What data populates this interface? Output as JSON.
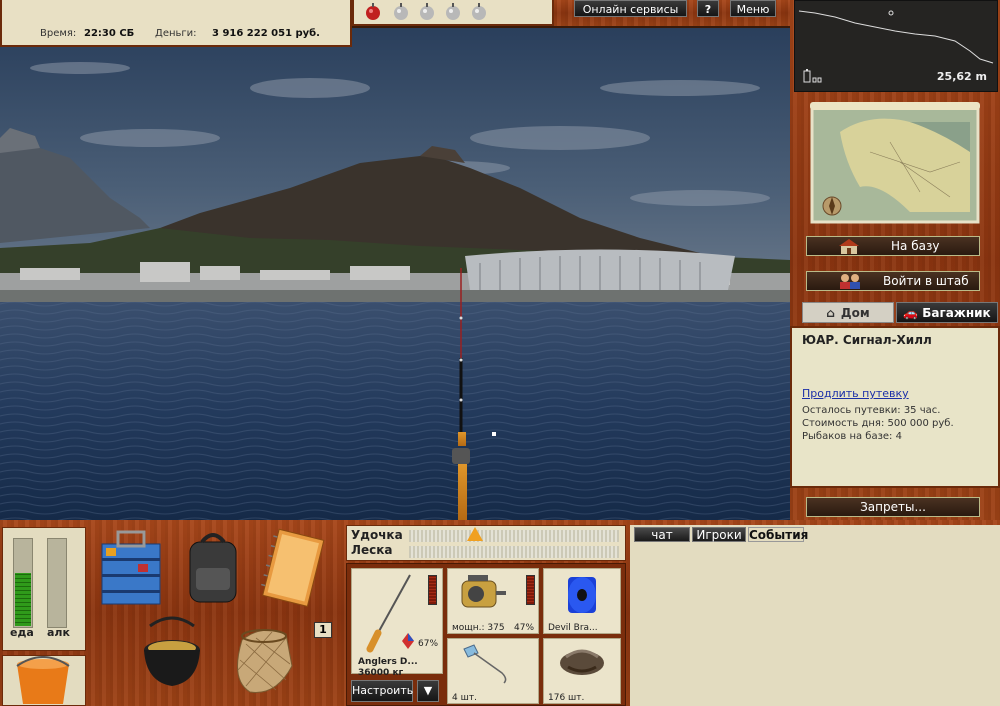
{
  "top": {
    "time_label": "Время:",
    "time_value": "22:30 СБ",
    "money_label": "Деньги:",
    "money_value": "3 916 222 051 руб.",
    "online_button": "Онлайн сервисы",
    "help_button": "?",
    "menu_button": "Меню"
  },
  "depth": {
    "value": "25,62 m"
  },
  "nav": {
    "to_base": "На базу",
    "enter_hq": "Войти в штаб",
    "tab_home": "Дом",
    "tab_trunk": "Багажник",
    "bans_button": "Запреты..."
  },
  "info": {
    "location": "ЮАР. Сигнал-Хилл",
    "extend_link": "Продлить путевку",
    "remaining": "Осталось путевки: 35 час.",
    "day_cost": "Стоимость дня: 500 000 руб.",
    "anglers": "Рыбаков на базе: 4"
  },
  "meters": {
    "food_label": "еда",
    "food_level": 0.62,
    "alc_label": "алк",
    "alc_level": 0.0
  },
  "inventory": {
    "count_badge": "1"
  },
  "rodline": {
    "rod_label": "Удочка",
    "line_label": "Леска",
    "rod_tension": 0.3,
    "line_tension": 0.0
  },
  "tackle": {
    "rod_name": "Anglers D...",
    "rod_test": "36000 кг",
    "rod_percent": "67%",
    "reel_power": "мощн.: 375",
    "reel_percent": "47%",
    "line_name": "Devil Bra...",
    "float_count": "4 шт.",
    "bait_count": "176 шт.",
    "configure_button": "Настроить",
    "dropdown_button": "▼"
  },
  "chat": {
    "tab_chat": "чат",
    "tab_players": "Игроки",
    "tab_events": "События"
  },
  "colors": {
    "wood": "#8c3510",
    "panel": "#e8e0c4",
    "meter_green": "#2f9a1a",
    "link": "#1b2fa8"
  }
}
